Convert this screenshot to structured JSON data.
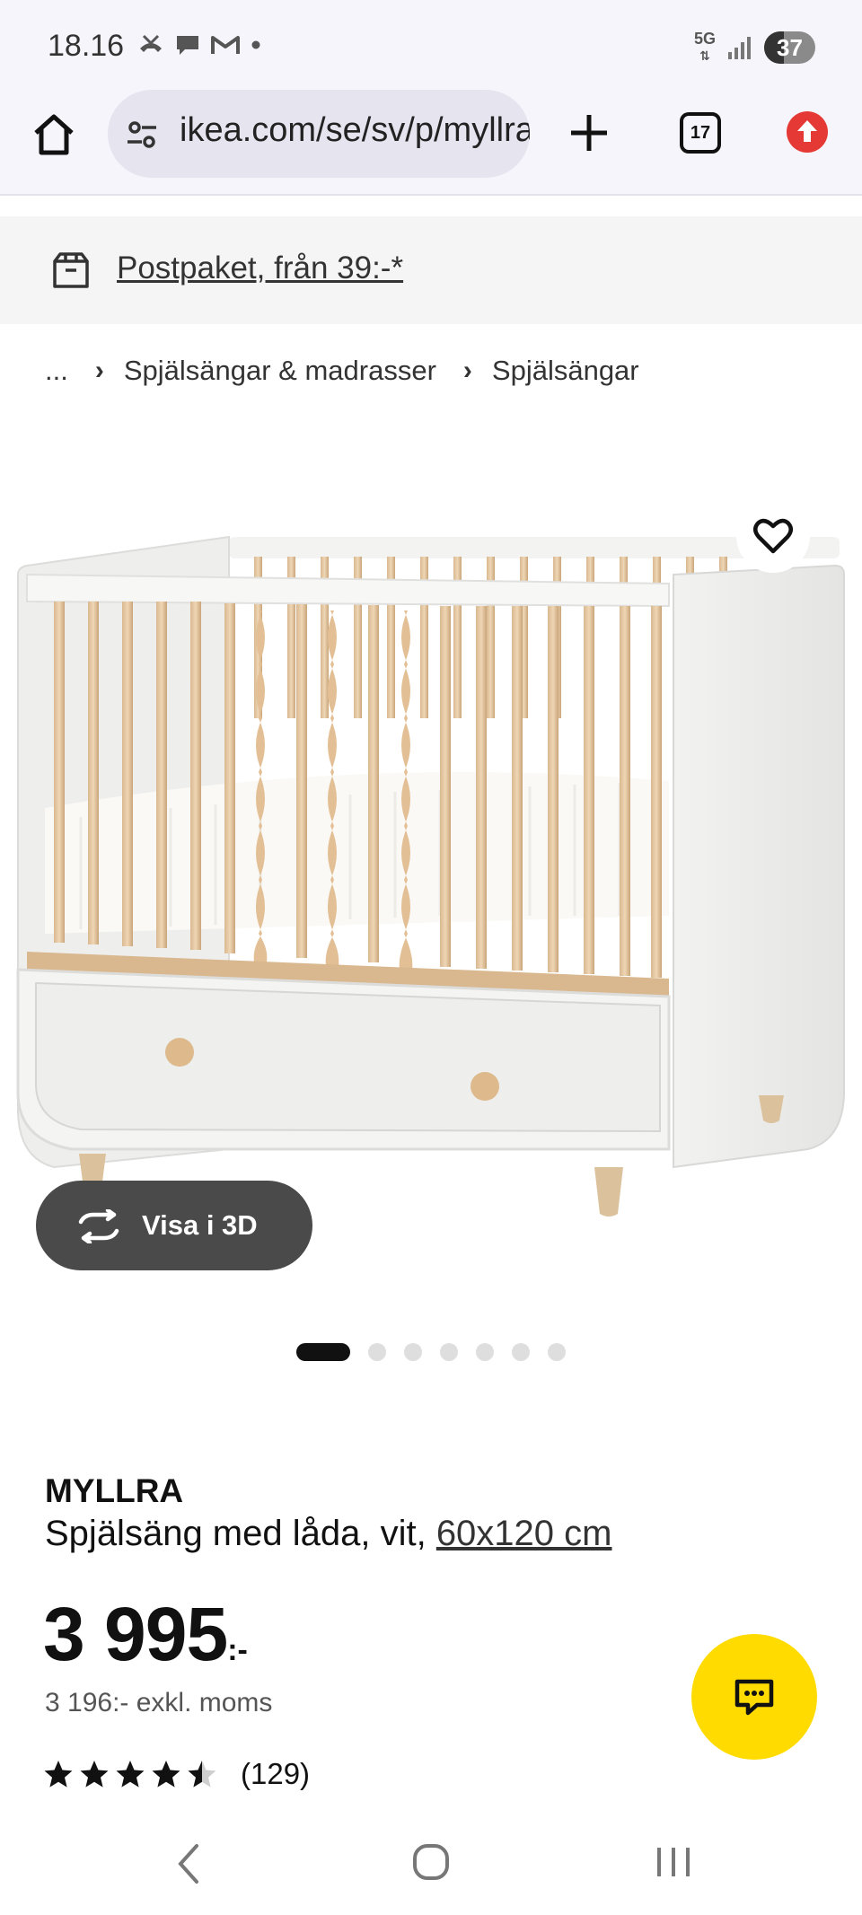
{
  "status_bar": {
    "time": "18.16",
    "network": "5G",
    "battery": "37",
    "icons": [
      "missed-call-icon",
      "chat-bubble-icon",
      "gmail-icon",
      "dot-icon",
      "signal-icon"
    ]
  },
  "browser": {
    "url": "ikea.com/se/sv/p/myllra-spjalsang-med-lada-vit",
    "tab_count": "17",
    "icons": [
      "home-icon",
      "site-settings-icon",
      "new-tab-plus-icon",
      "tabs-icon",
      "update-icon"
    ]
  },
  "banner": {
    "link_text": "Postpaket, från 39:-*",
    "icon": "package-icon"
  },
  "breadcrumbs": {
    "ellipsis": "...",
    "items": [
      "Spjälsängar & madrasser",
      "Spjälsängar"
    ]
  },
  "gallery": {
    "view_3d_label": "Visa i 3D",
    "dot_count": 7,
    "active_index": 0
  },
  "product": {
    "name": "MYLLRA",
    "description": "Spjälsäng med låda, vit, ",
    "size": "60x120 cm",
    "price": "3 995",
    "price_suffix": ":-",
    "price_excl_vat": "3 196:- exkl. moms",
    "rating": 4.5,
    "rating_count": "(129)"
  },
  "colors": {
    "brand_yellow": "#ffdb00",
    "dark_button": "#4a4a4a",
    "alert_red": "#e53935"
  }
}
